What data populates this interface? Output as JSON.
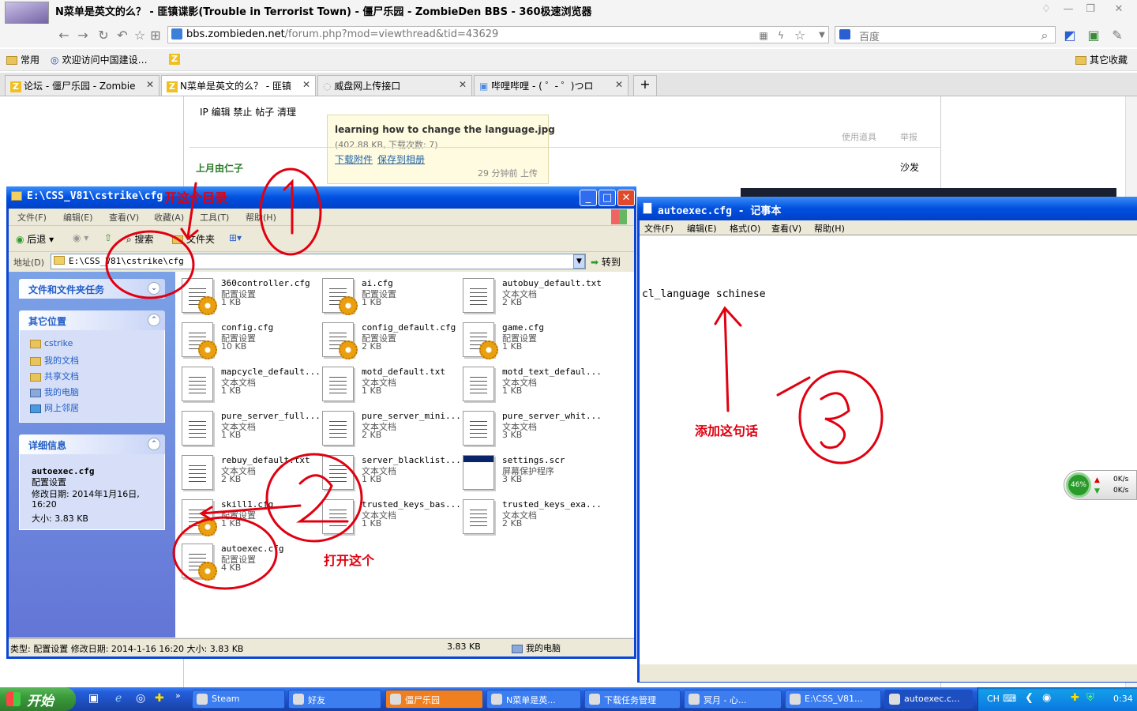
{
  "browser": {
    "title": "N菜单是英文的么？ - 匪镇谍影(Trouble in Terrorist Town) - 僵尸乐园 - ZombieDen BBS - 360极速浏览器",
    "url_host": "bbs.zombieden.net",
    "url_path": "/forum.php?mod=viewthread&tid=43629",
    "search_placeholder": "百度",
    "bookmarks": [
      "常用",
      "欢迎访问中国建设…",
      "其它收藏"
    ],
    "tabs": [
      {
        "label": "论坛 - 僵尸乐园 - Zombie"
      },
      {
        "label": "N菜单是英文的么？ - 匪镇"
      },
      {
        "label": "威盘网上传接口"
      },
      {
        "label": "哔哩哔哩 - ( ゜- ゜)つロ"
      }
    ],
    "new_tab_label": "+"
  },
  "forum": {
    "admin_links": "IP 编辑 禁止 帖子 清理",
    "attachment_name": "learning how to change the language.jpg",
    "attachment_meta": "(402.88 KB, 下载次数: 7)",
    "download_link": "下载附件",
    "save_album_link": "保存到相册",
    "upload_time": "29 分钟前 上传",
    "use_tool": "使用道具",
    "report": "举报",
    "username": "上月由仁子",
    "sofa": "沙发"
  },
  "explorer": {
    "title": "E:\\CSS_V81\\cstrike\\cfg",
    "menu": [
      "文件(F)",
      "编辑(E)",
      "查看(V)",
      "收藏(A)",
      "工具(T)",
      "帮助(H)"
    ],
    "back_label": "后退",
    "search_label": "搜索",
    "folders_label": "文件夹",
    "address_label": "地址(D)",
    "address_value": "E:\\CSS_V81\\cstrike\\cfg",
    "go_label": "转到",
    "panel_tasks": "文件和文件夹任务",
    "panel_places": "其它位置",
    "places": [
      "cstrike",
      "我的文档",
      "共享文档",
      "我的电脑",
      "网上邻居"
    ],
    "panel_details": "详细信息",
    "details_name": "autoexec.cfg",
    "details_type": "配置设置",
    "details_modified": "修改日期: 2014年1月16日, 16:20",
    "details_size": "大小: 3.83 KB",
    "files": [
      {
        "name": "360controller.cfg",
        "type": "配置设置",
        "size": "1 KB",
        "icon": "cfg"
      },
      {
        "name": "ai.cfg",
        "type": "配置设置",
        "size": "1 KB",
        "icon": "cfg"
      },
      {
        "name": "autobuy_default.txt",
        "type": "文本文档",
        "size": "2 KB",
        "icon": "txt"
      },
      {
        "name": "config.cfg",
        "type": "配置设置",
        "size": "10 KB",
        "icon": "cfg"
      },
      {
        "name": "config_default.cfg",
        "type": "配置设置",
        "size": "2 KB",
        "icon": "cfg"
      },
      {
        "name": "game.cfg",
        "type": "配置设置",
        "size": "1 KB",
        "icon": "cfg"
      },
      {
        "name": "mapcycle_default...",
        "type": "文本文档",
        "size": "1 KB",
        "icon": "txt"
      },
      {
        "name": "motd_default.txt",
        "type": "文本文档",
        "size": "1 KB",
        "icon": "txt"
      },
      {
        "name": "motd_text_defaul...",
        "type": "文本文档",
        "size": "1 KB",
        "icon": "txt"
      },
      {
        "name": "pure_server_full...",
        "type": "文本文档",
        "size": "1 KB",
        "icon": "txt"
      },
      {
        "name": "pure_server_mini...",
        "type": "文本文档",
        "size": "2 KB",
        "icon": "txt"
      },
      {
        "name": "pure_server_whit...",
        "type": "文本文档",
        "size": "3 KB",
        "icon": "txt"
      },
      {
        "name": "rebuy_default.txt",
        "type": "文本文档",
        "size": "2 KB",
        "icon": "txt"
      },
      {
        "name": "server_blacklist...",
        "type": "文本文档",
        "size": "1 KB",
        "icon": "txt"
      },
      {
        "name": "settings.scr",
        "type": "屏幕保护程序",
        "size": "3 KB",
        "icon": "scr"
      },
      {
        "name": "skill1.cfg",
        "type": "配置设置",
        "size": "1 KB",
        "icon": "cfg"
      },
      {
        "name": "trusted_keys_bas...",
        "type": "文本文档",
        "size": "1 KB",
        "icon": "txt"
      },
      {
        "name": "trusted_keys_exa...",
        "type": "文本文档",
        "size": "2 KB",
        "icon": "txt"
      },
      {
        "name": "autoexec.cfg",
        "type": "配置设置",
        "size": "4 KB",
        "icon": "cfg"
      }
    ],
    "status_left": "类型: 配置设置 修改日期: 2014-1-16 16:20 大小: 3.83 KB",
    "status_size": "3.83 KB",
    "status_location": "我的电脑"
  },
  "notepad": {
    "title": "autoexec.cfg - 记事本",
    "menu": [
      "文件(F)",
      "编辑(E)",
      "格式(O)",
      "查看(V)",
      "帮助(H)"
    ],
    "content": "cl_language schinese"
  },
  "annotations": {
    "open_dir": "开这个目录",
    "open_this": "打开这个",
    "add_line": "添加这句话"
  },
  "net_widget": {
    "percent": "46%",
    "up": "0K/s",
    "down": "0K/s"
  },
  "taskbar": {
    "start": "开始",
    "items": [
      "Steam",
      "好友",
      "僵尸乐园",
      "N菜单是英...",
      "下载任务管理",
      "冥月 - 心...",
      "E:\\CSS_V81...",
      "autoexec.c..."
    ],
    "lang": "CH",
    "clock": "0:34"
  },
  "colors": {
    "xp_blue": "#0a46d8",
    "annotation_red": "#e00010"
  }
}
